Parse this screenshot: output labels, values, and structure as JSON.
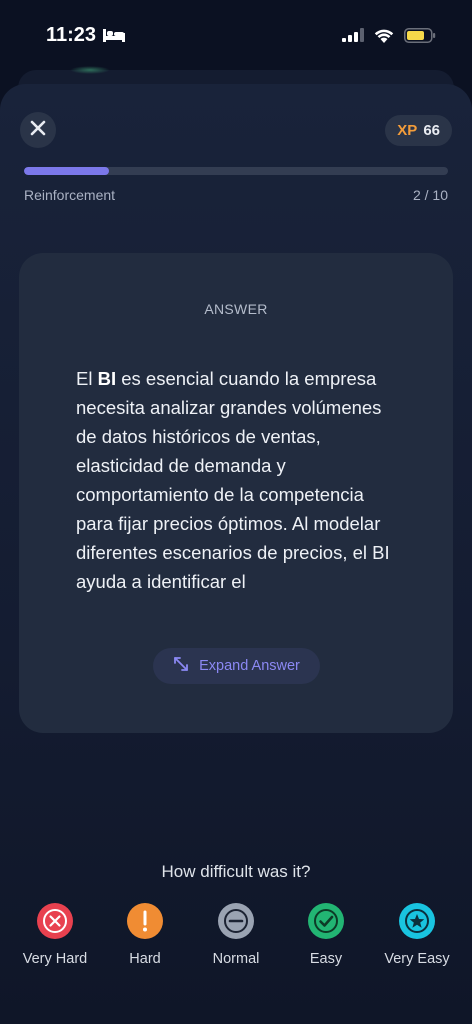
{
  "status_bar": {
    "time": "11:23",
    "bed_icon": "bed-icon",
    "signal_icon": "cellular-signal-icon",
    "wifi_icon": "wifi-icon",
    "battery_icon": "battery-icon",
    "battery_color": "#f6d94a"
  },
  "header": {
    "close_icon": "close-icon",
    "xp_label": "XP",
    "xp_value": "66",
    "xp_color": "#f39c3a"
  },
  "progress": {
    "label": "Reinforcement",
    "count": "2 / 10",
    "fraction": 0.2,
    "fill_color": "#7b78ea"
  },
  "card": {
    "heading": "ANSWER",
    "text_bold": "BI",
    "text_prefix": "El ",
    "text_rest": " es esencial cuando la empresa necesita analizar grandes volúmenes de datos históricos de ventas, elasticidad de demanda y comportamiento de la competencia para fijar precios óptimos. Al modelar diferentes escenarios de precios, el BI ayuda a identificar el",
    "expand_label": "Expand Answer",
    "expand_icon": "expand-arrows-icon"
  },
  "difficulty": {
    "title": "How difficult was it?",
    "options": [
      {
        "label": "Very Hard",
        "icon": "x-icon",
        "color": "#e8414f"
      },
      {
        "label": "Hard",
        "icon": "exclamation-icon",
        "color": "#f08c33"
      },
      {
        "label": "Normal",
        "icon": "minus-icon",
        "color": "#9aa3b2"
      },
      {
        "label": "Easy",
        "icon": "check-icon",
        "color": "#22b573"
      },
      {
        "label": "Very Easy",
        "icon": "star-icon",
        "color": "#19c4e0"
      }
    ]
  }
}
